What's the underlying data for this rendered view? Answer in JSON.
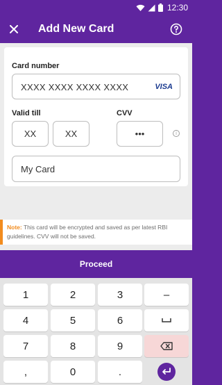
{
  "status_bar": {
    "time": "12:30"
  },
  "app_bar": {
    "title": "Add New Card"
  },
  "form": {
    "card_number_label": "Card number",
    "card_number_placeholder": "XXXX XXXX XXXX XXXX",
    "card_brand": "VISA",
    "valid_till_label": "Valid till",
    "month_placeholder": "XX",
    "year_placeholder": "XX",
    "cvv_label": "CVV",
    "cvv_value": "•••",
    "card_name_value": "My Card"
  },
  "note": {
    "label": "Note:",
    "text": " This card will be encrypted and saved as per latest RBI guidelines. CVV will not be saved."
  },
  "proceed_label": "Proceed",
  "keypad": {
    "keys": [
      "1",
      "2",
      "3",
      "–",
      "4",
      "5",
      "6",
      "␣",
      "7",
      "8",
      "9",
      "",
      ",",
      "0",
      ".",
      ""
    ]
  },
  "colors": {
    "brand": "#5f259f",
    "note_accent": "#f28c1e",
    "visa": "#1a3a8f"
  }
}
